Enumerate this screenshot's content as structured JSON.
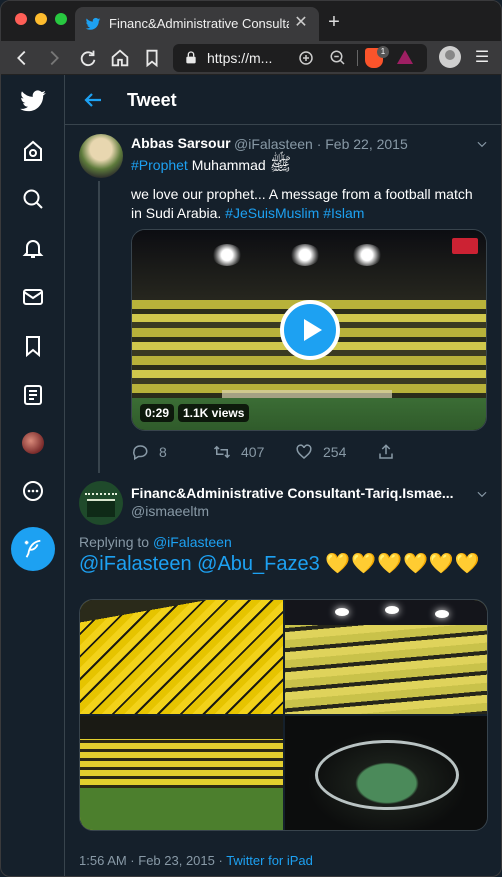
{
  "browser": {
    "tab_title": "Financ&Administrative Consultar",
    "tab_close": "✕",
    "new_tab": "+",
    "url": "https://m...",
    "brave_badge": "1",
    "menu": "☰"
  },
  "header": {
    "title": "Tweet"
  },
  "tweet1": {
    "name": "Abbas Sarsour",
    "meta": "@iFalasteen · Feb 22, 2015",
    "line1_tag": "#Prophet",
    "line1_text": " Muhammad ",
    "line1_honorific": "ﷺ",
    "body_text": "we love our prophet... A message from a football match in Sudi Arabia. ",
    "body_tag1": "#JeSuisMuslim",
    "body_tag2": "#Islam",
    "video_time": "0:29",
    "video_views": "1.1K views",
    "replies": "8",
    "retweets": "407",
    "likes": "254"
  },
  "tweet2": {
    "name": "Financ&Administrative Consultant-Tariq.Ismae...",
    "handle": "@ismaeeltm",
    "replying_label": "Replying to ",
    "replying_handle": "@iFalasteen",
    "text": "@iFalasteen @Abu_Faze3 ",
    "hearts": "💛💛💛💛💛💛",
    "timestamp": "1:56 AM · Feb 23, 2015 · ",
    "source": "Twitter for iPad"
  },
  "colors": {
    "accent": "#1da1f2",
    "background": "#15202b",
    "muted": "#8899a6"
  }
}
